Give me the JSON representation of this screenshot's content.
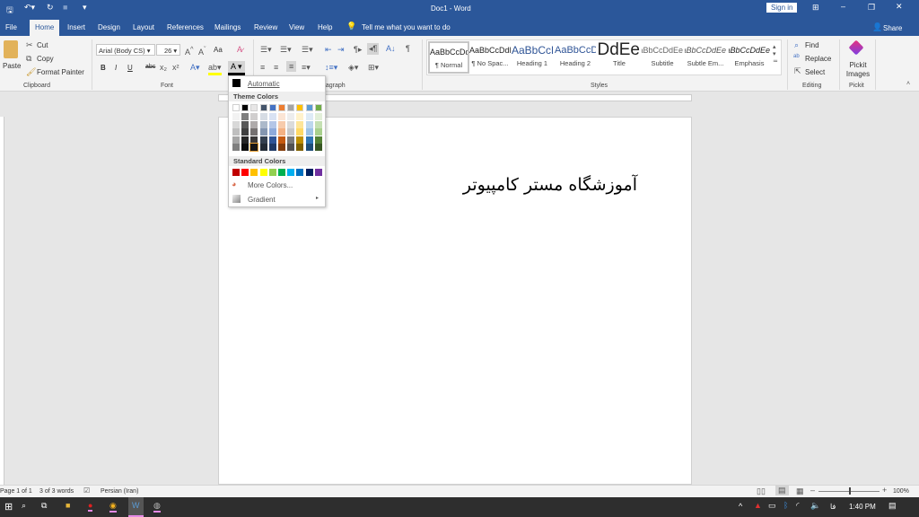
{
  "titlebar": {
    "title": "Doc1  -  Word",
    "sign_in": "Sign in"
  },
  "tabs": [
    "File",
    "Home",
    "Insert",
    "Design",
    "Layout",
    "References",
    "Mailings",
    "Review",
    "View",
    "Help"
  ],
  "tell_me": "Tell me what you want to do",
  "share": "Share",
  "clipboard": {
    "paste": "Paste",
    "cut": "Cut",
    "copy": "Copy",
    "format_painter": "Format Painter",
    "label": "Clipboard"
  },
  "font": {
    "name": "Arial (Body CS)",
    "size": "26",
    "label": "Font",
    "bold": "B",
    "italic": "I",
    "underline": "U",
    "strike": "abc",
    "aa": "Aa"
  },
  "paragraph": {
    "label": "Paragraph"
  },
  "styles": {
    "label": "Styles",
    "items": [
      {
        "preview": "AaBbCcDdEe",
        "name": "¶ Normal"
      },
      {
        "preview": "AaBbCcDdEe",
        "name": "¶ No Spac..."
      },
      {
        "preview": "AaBbCcDdEe",
        "name": "Heading 1"
      },
      {
        "preview": "AaBbCcDdEe",
        "name": "Heading 2"
      },
      {
        "preview": "AaBbCcDdEe",
        "name": "Title"
      },
      {
        "preview": "AaBbCcDdEe",
        "name": "Subtitle"
      },
      {
        "preview": "AaBbCcDdEe",
        "name": "Subtle Em..."
      },
      {
        "preview": "AaBbCcDdEe",
        "name": "Emphasis"
      }
    ]
  },
  "editing": {
    "find": "Find",
    "replace": "Replace",
    "select": "Select",
    "label": "Editing"
  },
  "pickit": {
    "button": "Pickit Images",
    "label": "Pickit"
  },
  "color_menu": {
    "automatic": "Automatic",
    "theme_header": "Theme Colors",
    "standard_header": "Standard Colors",
    "more_colors": "More Colors...",
    "gradient": "Gradient",
    "theme_colors": [
      [
        "#ffffff",
        "#f2f2f2",
        "#d9d9d9",
        "#bfbfbf",
        "#a6a6a6",
        "#7f7f7f"
      ],
      [
        "#000000",
        "#7f7f7f",
        "#595959",
        "#404040",
        "#262626",
        "#0d0d0d"
      ],
      [
        "#e7e6e6",
        "#d0cece",
        "#aeaaaa",
        "#757171",
        "#3a3838",
        "#171616"
      ],
      [
        "#44546a",
        "#d6dce4",
        "#acb9ca",
        "#8496b0",
        "#333f4f",
        "#222a35"
      ],
      [
        "#4472c4",
        "#d9e2f3",
        "#b4c6e7",
        "#8eaadb",
        "#2f5496",
        "#1f3864"
      ],
      [
        "#ed7d31",
        "#fbe5d5",
        "#f7cbac",
        "#f4b183",
        "#c55a11",
        "#833c0b"
      ],
      [
        "#a5a5a5",
        "#ededed",
        "#dbdbdb",
        "#c9c9c9",
        "#7b7b7b",
        "#525252"
      ],
      [
        "#ffc000",
        "#fff2cc",
        "#fee599",
        "#ffd965",
        "#bf8f00",
        "#7f6000"
      ],
      [
        "#5b9bd5",
        "#deebf6",
        "#bdd7ee",
        "#9dc3e6",
        "#2e75b5",
        "#1e4e79"
      ],
      [
        "#70ad47",
        "#e2efd9",
        "#c5e0b3",
        "#a8d08d",
        "#538135",
        "#375623"
      ]
    ],
    "standard_colors": [
      "#c00000",
      "#ff0000",
      "#ffc000",
      "#ffff00",
      "#92d050",
      "#00b050",
      "#00b0f0",
      "#0070c0",
      "#002060",
      "#7030a0"
    ]
  },
  "document": {
    "text": "آموزشگاه مستر کامپیوتر"
  },
  "status": {
    "page": "Page 1 of 1",
    "words": "3 of 3 words",
    "language": "Persian (Iran)",
    "zoom": "100%"
  },
  "taskbar": {
    "time": "1:40 PM",
    "lang": "فا"
  },
  "colors": {
    "accent": "#2b579a"
  }
}
